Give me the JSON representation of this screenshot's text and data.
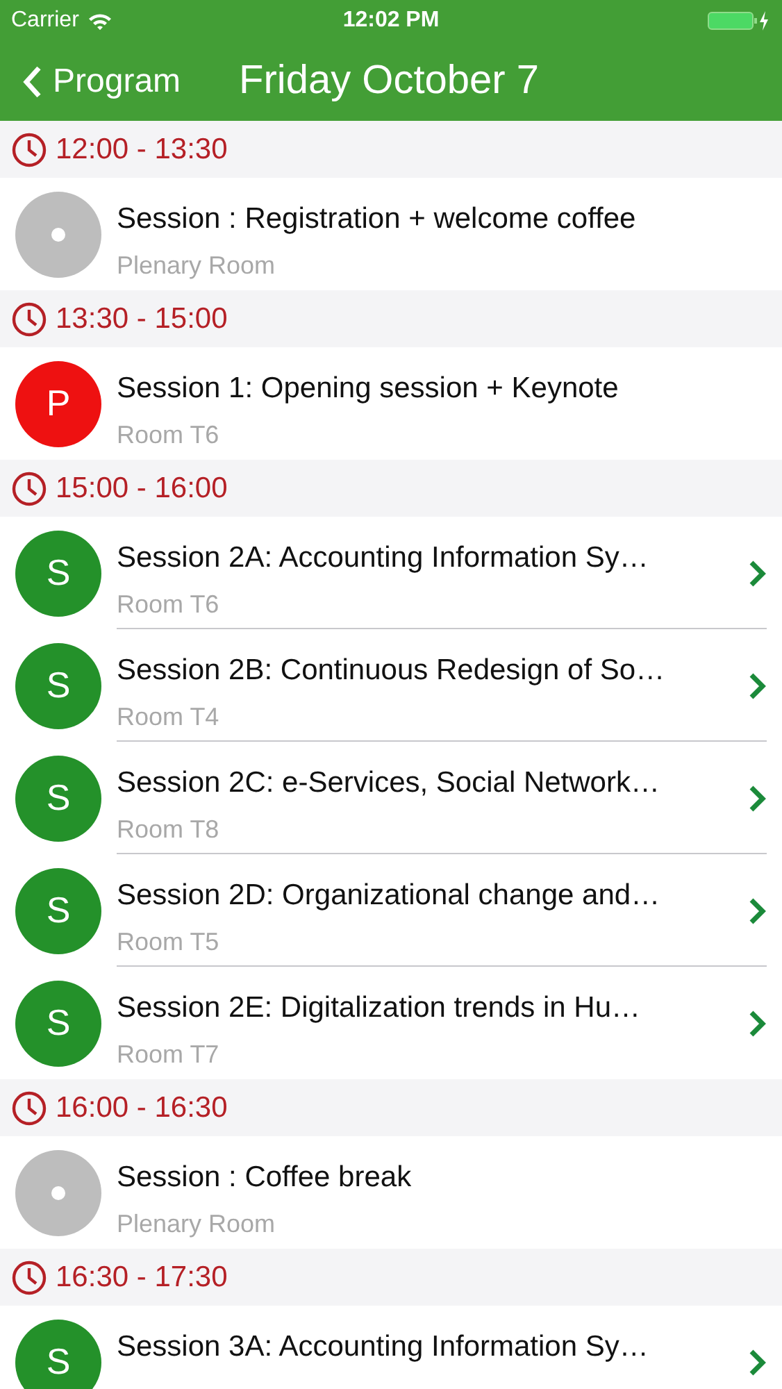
{
  "status_bar": {
    "carrier": "Carrier",
    "time": "12:02 PM"
  },
  "nav": {
    "back": "Program",
    "title": "Friday October 7"
  },
  "sections": [
    {
      "time": "12:00 - 13:30",
      "items": [
        {
          "kind": "dot",
          "color": "#bdbdbd",
          "title": "Session : Registration + welcome coffee",
          "room": "Plenary Room",
          "disclosure": false
        }
      ]
    },
    {
      "time": "13:30 - 15:00",
      "items": [
        {
          "kind": "letter",
          "letter": "P",
          "color": "#ee1111",
          "title": "Session 1: Opening session + Keynote",
          "room": "Room T6",
          "disclosure": false
        }
      ]
    },
    {
      "time": "15:00 - 16:00",
      "items": [
        {
          "kind": "letter",
          "letter": "S",
          "color": "#24912a",
          "title": "Session 2A: Accounting Information Sy…",
          "room": "Room T6",
          "disclosure": true
        },
        {
          "kind": "letter",
          "letter": "S",
          "color": "#24912a",
          "title": "Session 2B: Continuous Redesign of So…",
          "room": "Room T4",
          "disclosure": true
        },
        {
          "kind": "letter",
          "letter": "S",
          "color": "#24912a",
          "title": "Session 2C: e-Services, Social Network…",
          "room": "Room T8",
          "disclosure": true
        },
        {
          "kind": "letter",
          "letter": "S",
          "color": "#24912a",
          "title": "Session 2D: Organizational change and…",
          "room": "Room T5",
          "disclosure": true
        },
        {
          "kind": "letter",
          "letter": "S",
          "color": "#24912a",
          "title": "Session 2E: Digitalization trends in Hu…",
          "room": "Room T7",
          "disclosure": true
        }
      ]
    },
    {
      "time": "16:00 - 16:30",
      "items": [
        {
          "kind": "dot",
          "color": "#bdbdbd",
          "title": "Session : Coffee break",
          "room": "Plenary Room",
          "disclosure": false
        }
      ]
    },
    {
      "time": "16:30 - 17:30",
      "items": [
        {
          "kind": "letter",
          "letter": "S",
          "color": "#24912a",
          "title": "Session 3A: Accounting Information Sy…",
          "disclosure": true
        }
      ]
    }
  ]
}
